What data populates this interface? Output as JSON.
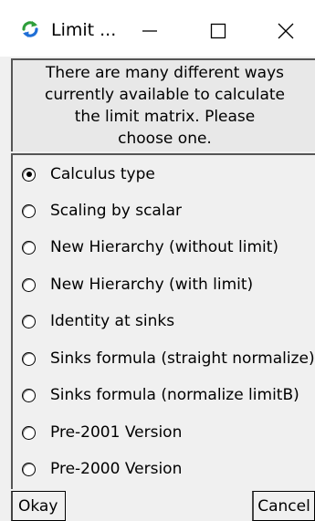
{
  "window": {
    "title": "Limit ...",
    "icon": "refresh-arrows-icon",
    "icon_colors": [
      "#2e9e3a",
      "#1f6fd6"
    ]
  },
  "message": {
    "lines": [
      "There are many different ways",
      "currently available to calculate",
      "the limit matrix.  Please",
      "choose one."
    ]
  },
  "options": [
    {
      "label": "Calculus type",
      "selected": true
    },
    {
      "label": "Scaling by scalar",
      "selected": false
    },
    {
      "label": "New Hierarchy (without limit)",
      "selected": false
    },
    {
      "label": "New Hierarchy (with limit)",
      "selected": false
    },
    {
      "label": "Identity at sinks",
      "selected": false
    },
    {
      "label": "Sinks formula (straight normalize)",
      "selected": false
    },
    {
      "label": "Sinks formula (normalize limitB)",
      "selected": false
    },
    {
      "label": "Pre-2001 Version",
      "selected": false
    },
    {
      "label": "Pre-2000 Version",
      "selected": false
    }
  ],
  "buttons": {
    "okay": "Okay",
    "cancel": "Cancel"
  }
}
